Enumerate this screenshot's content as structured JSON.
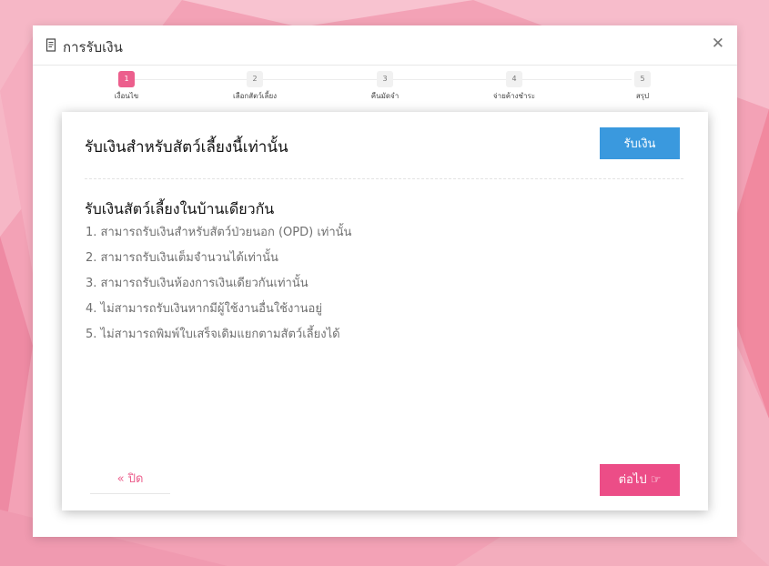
{
  "window": {
    "title": "การรับเงิน",
    "close_symbol": "✕",
    "title_icon": "receipt-icon"
  },
  "stepper": {
    "current_step": 1,
    "steps": [
      {
        "number": "1",
        "label": "เงื่อนไข"
      },
      {
        "number": "2",
        "label": "เลือกสัตว์เลี้ยง"
      },
      {
        "number": "3",
        "label": "คืนมัดจำ"
      },
      {
        "number": "4",
        "label": "จ่ายค้างชำระ"
      },
      {
        "number": "5",
        "label": "สรุป"
      }
    ]
  },
  "panel": {
    "title": "รับเงินสำหรับสัตว์เลี้ยงนี้เท่านั้น",
    "receive_button": "รับเงิน",
    "rules_heading": "รับเงินสัตว์เลี้ยงในบ้านเดียวกัน",
    "rules": [
      "1. สามารถรับเงินสำหรับสัตว์ป่วยนอก (OPD) เท่านั้น",
      "2. สามารถรับเงินเต็มจำนวนได้เท่านั้น",
      "3. สามารถรับเงินห้องการเงินเดียวกันเท่านั้น",
      "4. ไม่สามารถรับเงินหากมีผู้ใช้งานอื่นใช้งานอยู่",
      "5. ไม่สามารถพิมพ์ใบเสร็จเดิมแยกตามสัตว์เลี้ยงได้"
    ],
    "close_button": {
      "icon": "«",
      "label": "ปิด"
    },
    "next_button": {
      "label": "ต่อไป",
      "icon": "☞"
    }
  },
  "colors": {
    "primary_blue": "#3a99de",
    "accent_pink": "#ec4d87",
    "step_active": "#ec5f8d",
    "background_pink": "#f3a2b6"
  }
}
